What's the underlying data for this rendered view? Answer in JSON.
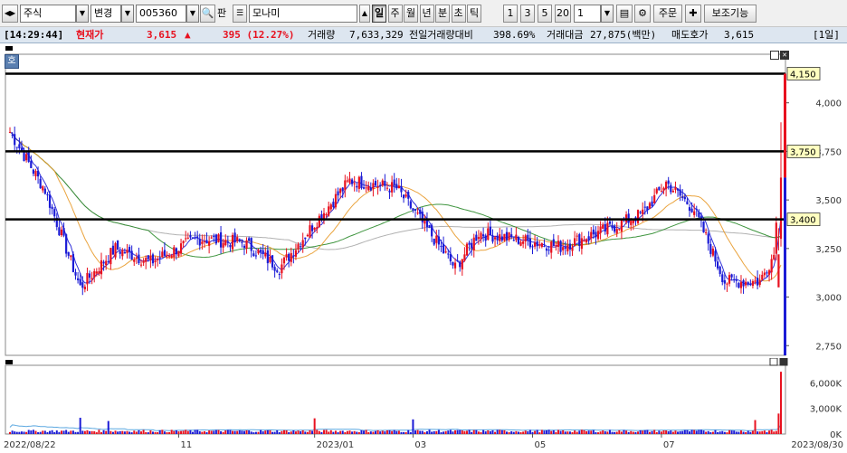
{
  "toolbar": {
    "market_label": "주식",
    "change_label": "변경",
    "stock_code": "005360",
    "pan_label": "판",
    "stock_name": "모나미",
    "period_buttons": [
      "일",
      "주",
      "월",
      "년",
      "분",
      "초",
      "틱"
    ],
    "selected_period": "일",
    "interval_buttons": [
      "1",
      "3",
      "5",
      "20"
    ],
    "interval_value": "1",
    "order_label": "주문",
    "aux_label": "보조기능"
  },
  "info_bar": {
    "time": "[14:29:44]",
    "price_label": "현재가",
    "price": "3,615",
    "change_symbol": "▲",
    "change": "395 (12.27%)",
    "volume_label": "거래량",
    "volume": "7,633,329",
    "prev_ratio_label": "전일거래량대비",
    "prev_ratio": "398.69%",
    "amount_label": "거래대금",
    "amount": "27,875(백만)",
    "ask_label": "매도호가",
    "ask": "3,615",
    "period_tag": "[1일]"
  },
  "price_panel": {
    "badge": "호",
    "y_ticks": [
      "4,000",
      "3,750",
      "3,500",
      "3,250",
      "3,000",
      "2,750"
    ],
    "hlines": [
      {
        "value": 4150,
        "label": "4,150"
      },
      {
        "value": 3750,
        "label": "3,750"
      },
      {
        "value": 3400,
        "label": "3,400"
      }
    ],
    "current_value": 3615
  },
  "volume_panel": {
    "y_ticks": [
      "6,000K",
      "3,000K",
      "0K"
    ]
  },
  "x_axis": {
    "start_label": "2022/08/22",
    "end_label": "2023/08/30",
    "month_labels": [
      {
        "label": "11",
        "day": 72
      },
      {
        "label": "2023/01",
        "day": 130
      },
      {
        "label": "03",
        "day": 172
      },
      {
        "label": "05",
        "day": 223
      },
      {
        "label": "07",
        "day": 278
      }
    ]
  },
  "colors": {
    "up": "#e8111f",
    "down": "#1b1bd6",
    "ma5": "#1b1bd6",
    "ma20": "#e89a2a",
    "ma60": "#2a8a2a",
    "ma120": "#a8a8a8",
    "hline": "#000000",
    "label_bg": "#ffffc0"
  },
  "chart_data": {
    "type": "candlestick",
    "x_range": [
      "2022/08/22",
      "2023/08/30"
    ],
    "ylim": [
      2700,
      4250
    ],
    "key_points": [
      {
        "day": 0,
        "close": 3850
      },
      {
        "day": 15,
        "close": 3550
      },
      {
        "day": 30,
        "close": 3050
      },
      {
        "day": 45,
        "close": 3250
      },
      {
        "day": 60,
        "close": 3180
      },
      {
        "day": 80,
        "close": 3300
      },
      {
        "day": 100,
        "close": 3280
      },
      {
        "day": 115,
        "close": 3150
      },
      {
        "day": 130,
        "close": 3380
      },
      {
        "day": 145,
        "close": 3600
      },
      {
        "day": 165,
        "close": 3560
      },
      {
        "day": 178,
        "close": 3350
      },
      {
        "day": 190,
        "close": 3150
      },
      {
        "day": 200,
        "close": 3330
      },
      {
        "day": 215,
        "close": 3300
      },
      {
        "day": 235,
        "close": 3260
      },
      {
        "day": 255,
        "close": 3350
      },
      {
        "day": 270,
        "close": 3430
      },
      {
        "day": 280,
        "close": 3590
      },
      {
        "day": 292,
        "close": 3450
      },
      {
        "day": 305,
        "close": 3080
      },
      {
        "day": 320,
        "close": 3080
      },
      {
        "day": 326,
        "close": 3220
      },
      {
        "day": 328,
        "close": 3615
      }
    ],
    "volume_peak_k": 7633
  }
}
